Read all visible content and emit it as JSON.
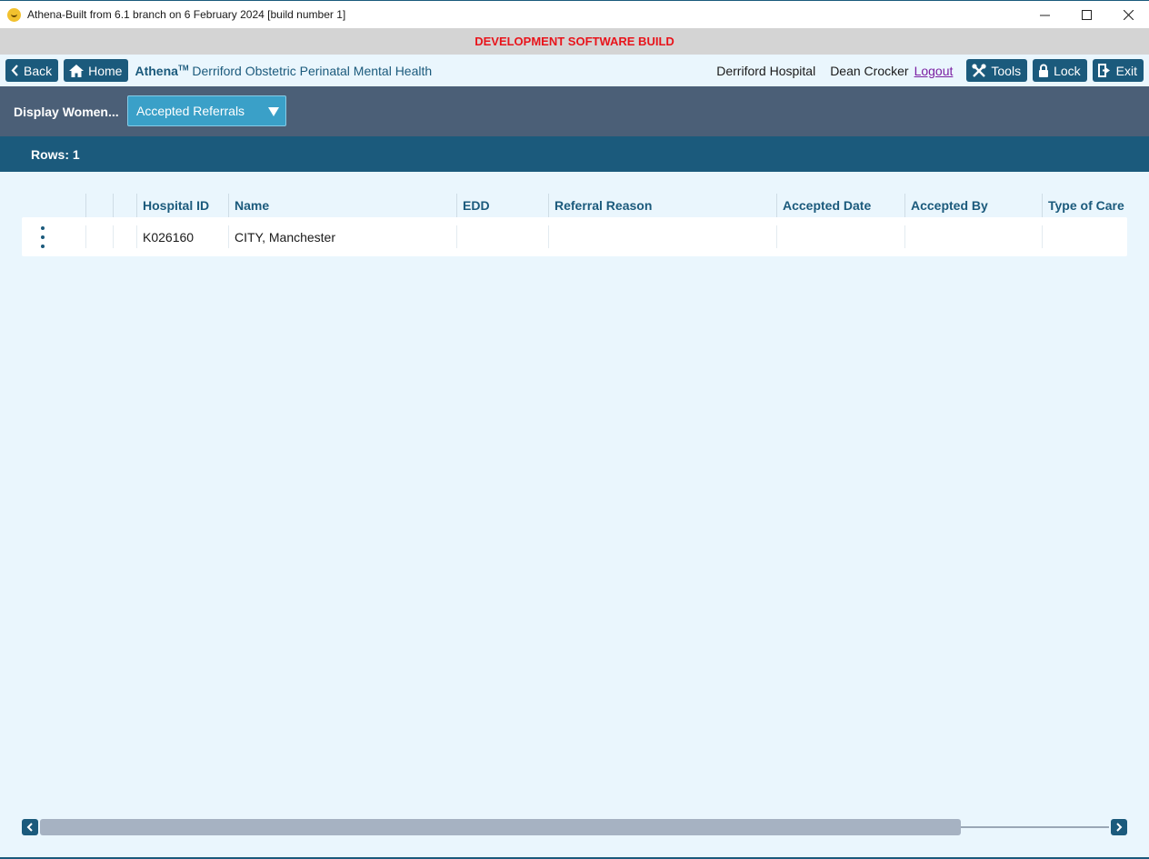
{
  "window": {
    "title": "Athena-Built from 6.1 branch on 6 February 2024 [build number 1]",
    "minimize": "—",
    "maximize": "☐",
    "close": "✕"
  },
  "banner": {
    "text": "DEVELOPMENT SOFTWARE BUILD",
    "color": "#e8141b"
  },
  "nav": {
    "back_label": "Back",
    "home_label": "Home",
    "brand": "Athena",
    "brand_tm": "TM",
    "module": "Derriford Obstetric Perinatal Mental Health",
    "hospital": "Derriford Hospital",
    "user": "Dean Crocker",
    "logout_label": "Logout",
    "tools_label": "Tools",
    "lock_label": "Lock",
    "exit_label": "Exit"
  },
  "filter": {
    "label": "Display Women...",
    "selected": "Accepted Referrals"
  },
  "rows_label": "Rows: 1",
  "table": {
    "columns": [
      "",
      "",
      "Hospital ID",
      "Name",
      "EDD",
      "Referral Reason",
      "Accepted Date",
      "Accepted By",
      "Type of Care"
    ],
    "rows": [
      {
        "hospital_id": "K026160",
        "name": "CITY, Manchester",
        "edd": "",
        "referral_reason": "",
        "accepted_date": "",
        "accepted_by": "",
        "type_of_care": ""
      }
    ]
  },
  "colors": {
    "primary": "#1b5a7c",
    "filter_bar": "#4b5f77",
    "select": "#3aa0c8",
    "background": "#eaf6fd"
  },
  "icons": [
    "chevron-left-icon",
    "home-icon",
    "tools-icon",
    "lock-icon",
    "exit-icon",
    "kebab-menu-icon",
    "dropdown-caret-icon"
  ]
}
